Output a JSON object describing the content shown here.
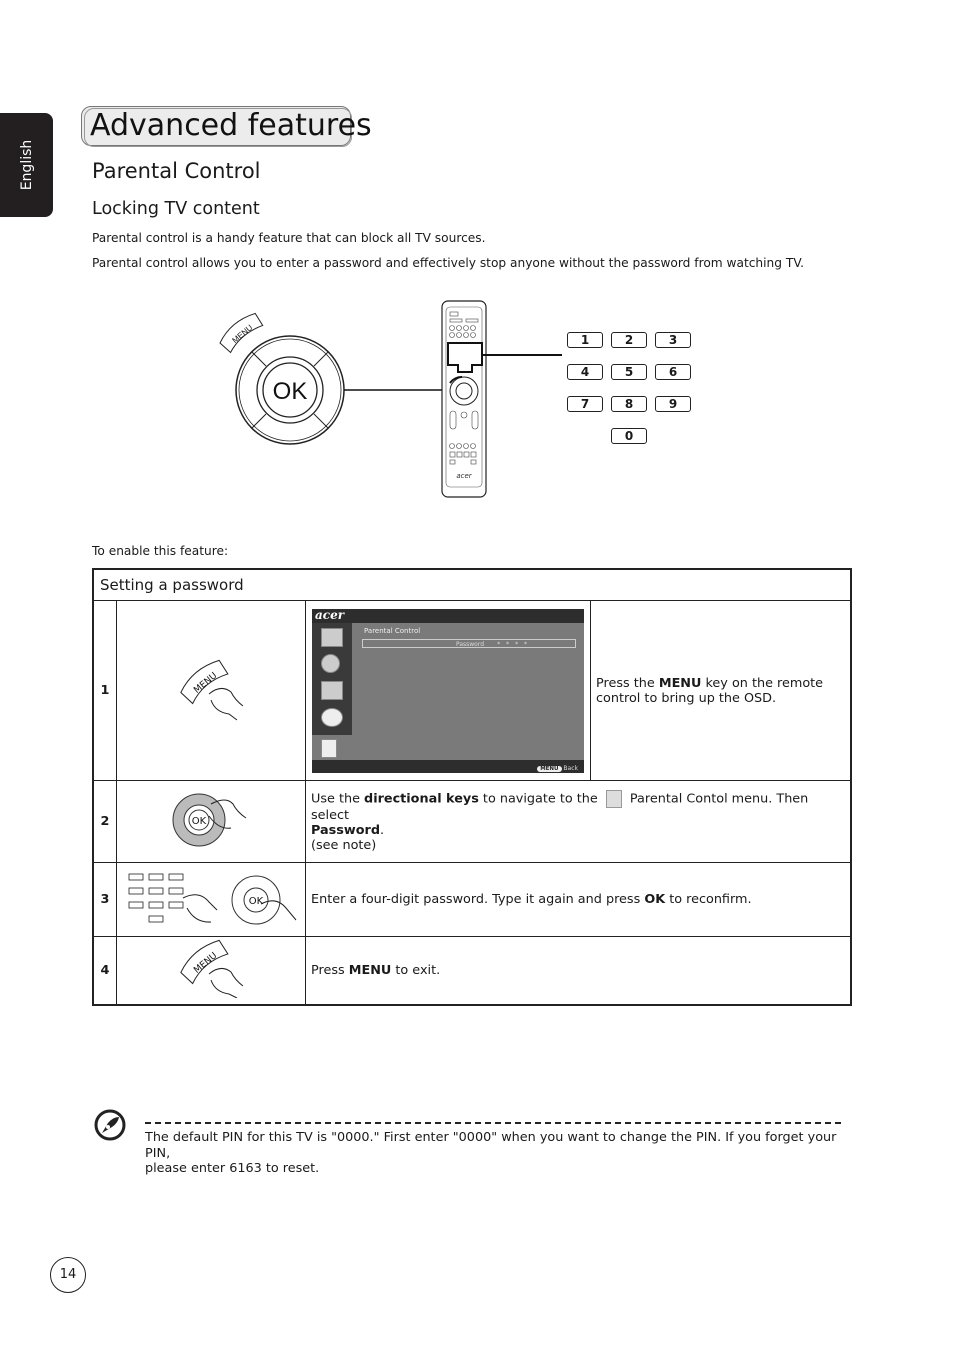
{
  "sidebar": {
    "language_tab": "English"
  },
  "header": {
    "title": "Advanced features"
  },
  "section": {
    "title": "Parental Control",
    "subtitle": "Locking TV content",
    "paragraphs": [
      "Parental control is a handy feature that can block all TV sources.",
      "Parental control allows you to enter a password and effectively stop anyone without the password from watching TV."
    ]
  },
  "diagram": {
    "menu_label": "MENU",
    "ok_label": "OK",
    "remote_brand": "acer",
    "keypad": [
      "1",
      "2",
      "3",
      "4",
      "5",
      "6",
      "7",
      "8",
      "9",
      "0"
    ]
  },
  "enable_text": "To enable this feature:",
  "table": {
    "header": "Setting a password",
    "osd": {
      "brand": "acer",
      "menu_title": "Parental Control",
      "row_label": "Password",
      "row_value": "* * * *",
      "footer_key": "MENU",
      "footer_label": "Back",
      "side_icons": [
        "picture-icon",
        "audio-icon",
        "channel-icon",
        "settings-icon",
        "parental-control-icon"
      ]
    },
    "steps": [
      {
        "num": "1",
        "illustration": "menu-key-press",
        "pre": "Press the ",
        "bold": "MENU",
        "post": " key on the remote control to bring up the OSD."
      },
      {
        "num": "2",
        "illustration": "directional-keys-press",
        "pre": "Use the ",
        "bold": "directional keys",
        "mid": " to navigate to the ",
        "mid2": " Parental Contol menu. Then select ",
        "bold2": "Password",
        "post": ".",
        "line3": "(see note)"
      },
      {
        "num": "3",
        "illustration": "keypad-and-ok-press",
        "pre": "Enter a four-digit password. Type it again and press ",
        "bold": "OK",
        "post": " to reconfirm."
      },
      {
        "num": "4",
        "illustration": "menu-key-press",
        "pre": "Press ",
        "bold": "MENU",
        "post": " to exit."
      }
    ]
  },
  "note": {
    "icon": "note-pen-icon",
    "line1": "The default PIN for this TV is \"0000.\" First enter \"0000\" when you want to change the PIN. If you forget your PIN,",
    "line2": "please enter 6163 to reset."
  },
  "footer": {
    "page_number": "14"
  }
}
